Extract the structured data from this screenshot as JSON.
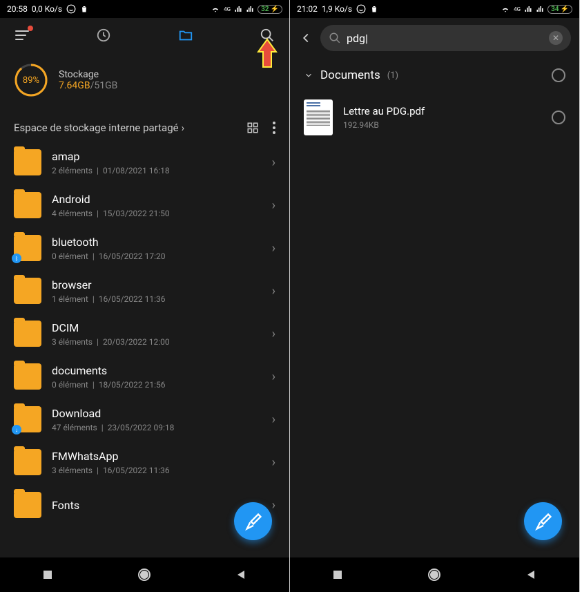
{
  "screen1": {
    "status": {
      "time": "20:58",
      "net_speed": "0,0 Ko/s",
      "battery": "32"
    },
    "storage": {
      "percent": "89%",
      "label": "Stockage",
      "used": "7.64GB",
      "total": "51GB"
    },
    "breadcrumb": "Espace de stockage interne partagé",
    "folders": [
      {
        "name": "amap",
        "count": "2 éléments",
        "date": "01/08/2021 16:18",
        "badge": null
      },
      {
        "name": "Android",
        "count": "4 éléments",
        "date": "15/03/2022 21:50",
        "badge": null
      },
      {
        "name": "bluetooth",
        "count": "0 élément",
        "date": "16/05/2022 17:20",
        "badge": "bt"
      },
      {
        "name": "browser",
        "count": "1 élément",
        "date": "16/05/2022 11:36",
        "badge": null
      },
      {
        "name": "DCIM",
        "count": "3 éléments",
        "date": "20/03/2022 12:00",
        "badge": null
      },
      {
        "name": "documents",
        "count": "0 élément",
        "date": "18/05/2022 21:56",
        "badge": null
      },
      {
        "name": "Download",
        "count": "47 éléments",
        "date": "23/05/2022 09:18",
        "badge": "dl"
      },
      {
        "name": "FMWhatsApp",
        "count": "3 éléments",
        "date": "16/05/2022 11:36",
        "badge": null
      },
      {
        "name": "Fonts",
        "count": "",
        "date": "",
        "badge": null
      }
    ]
  },
  "screen2": {
    "status": {
      "time": "21:02",
      "net_speed": "1,9 Ko/s",
      "battery": "34"
    },
    "search_query": "pdg",
    "section": {
      "title": "Documents",
      "count": "(1)"
    },
    "results": [
      {
        "name": "Lettre au PDG.pdf",
        "size": "192.94KB"
      }
    ]
  }
}
